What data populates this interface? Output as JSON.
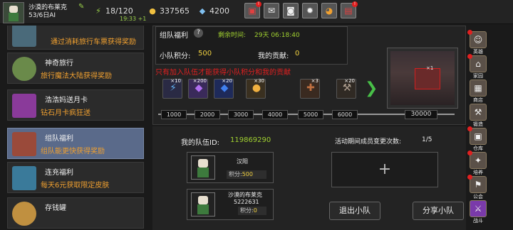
{
  "header": {
    "player_name": "沙漠的布莱克",
    "player_sub": "53/6日AI",
    "energy": "18/120",
    "energy_timer": "19:33 +1",
    "gold": "337565",
    "gems": "4200"
  },
  "menu": [
    {
      "title": "",
      "desc": "通过消耗旅行车票获得奖励"
    },
    {
      "title": "神奇旅行",
      "desc": "旅行魔法大陆获得奖励"
    },
    {
      "title": "浩浩妈送月卡",
      "desc": "钻石月卡疯狂送"
    },
    {
      "title": "组队福利",
      "desc": "组队能更快获得奖励"
    },
    {
      "title": "连充福利",
      "desc": "每天6元获取限定皮肤"
    },
    {
      "title": "存钱罐",
      "desc": ""
    }
  ],
  "panel": {
    "title": "组队福利",
    "remaining_label": "剩余时间:",
    "remaining_value": "29天 06:18:40",
    "team_score_label": "小队积分:",
    "team_score_value": "500",
    "my_contrib_label": "我的贡献:",
    "my_contrib_value": "0",
    "warning": "只有加入队伍才能获得小队积分和我的贡献",
    "preview_count": "×1"
  },
  "rewards": [
    {
      "count": "×10",
      "glyph": "⚡"
    },
    {
      "count": "×200",
      "glyph": "◆"
    },
    {
      "count": "×20",
      "glyph": "◆"
    },
    {
      "count": "×30",
      "glyph": "●"
    },
    {
      "count": "×3",
      "glyph": "✚"
    },
    {
      "count": "×20",
      "glyph": "⚒"
    }
  ],
  "milestones": [
    "1000",
    "2000",
    "3000",
    "4000",
    "5000",
    "6000",
    "30000"
  ],
  "team": {
    "id_label": "我的队伍ID:",
    "id_value": "119869290",
    "change_label": "活动期间成员变更次数:",
    "change_value": "1/5",
    "add_symbol": "+"
  },
  "members": [
    {
      "name": "汉阳",
      "score_label": "积分:",
      "score_value": "500",
      "extra": ""
    },
    {
      "name": "沙漠的布莱克",
      "score_label": "积分:",
      "score_value": "0",
      "extra": "5222631"
    }
  ],
  "buttons": {
    "leave": "退出小队",
    "share": "分享小队"
  },
  "right_nav": [
    "英雄",
    "家园",
    "商店",
    "锻造",
    "仓库",
    "培养",
    "公会",
    "战斗"
  ],
  "colors": {
    "accent_green": "#a0d030",
    "warning_red": "#e02020",
    "desc_orange": "#f0a030",
    "active_blue": "#5a6a8a"
  }
}
